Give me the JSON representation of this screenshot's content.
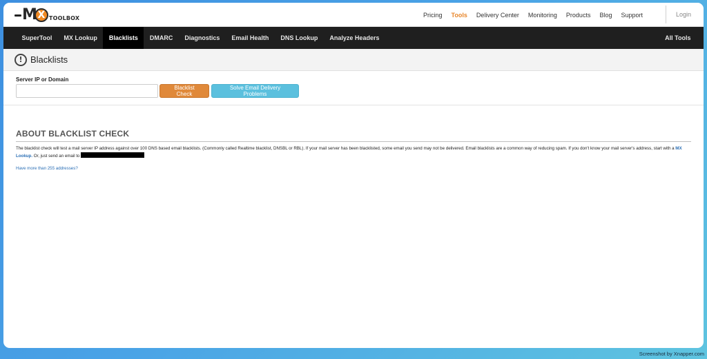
{
  "brand": {
    "logo_letter": "M",
    "logo_x": "X",
    "logo_word": "TOOLBOX"
  },
  "topnav": {
    "items": [
      "Pricing",
      "Tools",
      "Delivery Center",
      "Monitoring",
      "Products",
      "Blog",
      "Support"
    ],
    "active": "Tools",
    "login": "Login"
  },
  "mainnav": {
    "items": [
      "SuperTool",
      "MX Lookup",
      "Blacklists",
      "DMARC",
      "Diagnostics",
      "Email Health",
      "DNS Lookup",
      "Analyze Headers"
    ],
    "active": "Blacklists",
    "all_tools": "All Tools"
  },
  "page": {
    "title": "Blacklists",
    "title_icon": "exclamation-circle-icon"
  },
  "form": {
    "label": "Server IP or Domain",
    "input_value": "",
    "input_placeholder": "",
    "check_button": "Blacklist Check",
    "solve_button": "Solve Email Delivery Problems"
  },
  "about": {
    "heading": "ABOUT BLACKLIST CHECK",
    "text_1": "The blacklist check will test a mail server IP address against over 100 DNS based email blacklists. (Commonly called Realtime blacklist, DNSBL or RBL).  If your mail server has been blacklisted, some email you send may not be delivered.  Email blacklists are a common way of reducing spam.  If you don't know your mail server's address, start with a ",
    "mx_link": "MX Lookup.",
    "text_2": "  Or, just send an email to ",
    "more_link": "Have more than 255 addresses?"
  },
  "watermark": "Screenshot by Xnapper.com",
  "colors": {
    "accent_orange": "#e0893a",
    "accent_blue": "#5bc0de",
    "nav_dark": "#1f1f1f",
    "link": "#2a6eb5"
  }
}
